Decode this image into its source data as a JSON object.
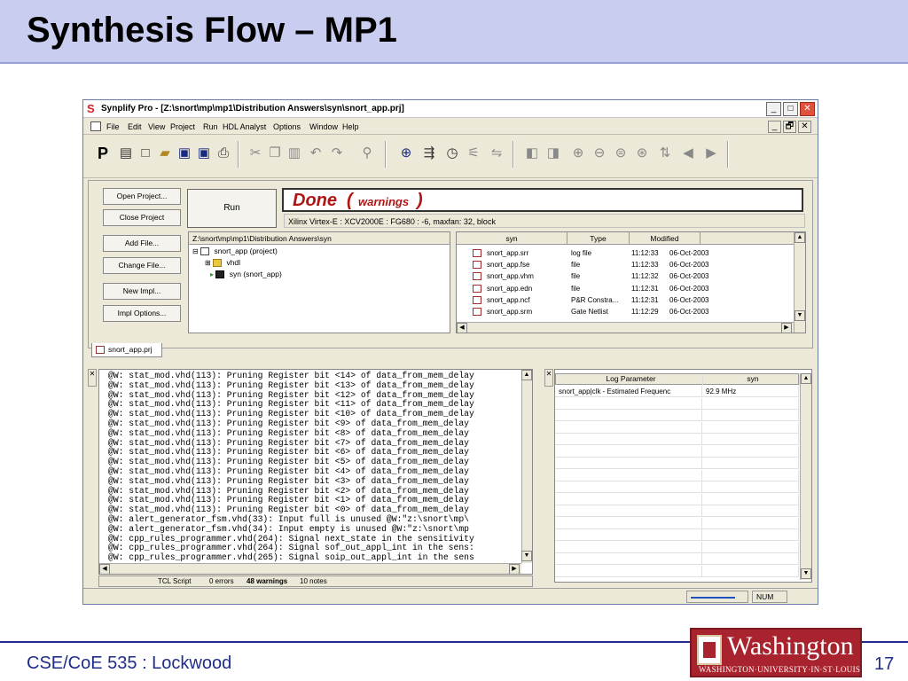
{
  "slide": {
    "title": "Synthesis Flow – MP1",
    "footer": "CSE/CoE 535 : Lockwood",
    "page_number": "17",
    "logo_main": "Washington",
    "logo_sub": "WASHINGTON·UNIVERSITY·IN·ST·LOUIS",
    "colors": {
      "header_bg": "#c9cdf0",
      "footer_text": "#1f2d8a",
      "logo_bg": "#a8232d"
    }
  },
  "window": {
    "title": "Synplify Pro - [Z:\\snort\\mp\\mp1\\Distribution Answers\\syn\\snort_app.prj]",
    "controls": {
      "minimize": "_",
      "maximize": "□",
      "close": "✕"
    },
    "mdi_controls": {
      "minimize": "_",
      "restore": "🗗",
      "close": "✕"
    }
  },
  "menu": [
    "File",
    "Edit",
    "View",
    "Project",
    "Run",
    "HDL Analyst",
    "Options",
    "Window",
    "Help"
  ],
  "toolbar": {
    "icons": [
      "p-logo-icon",
      "hdl-icon",
      "new-file-icon",
      "open-folder-icon",
      "save-icon",
      "save-all-icon",
      "print-icon",
      "cut-icon",
      "copy-icon",
      "paste-icon",
      "undo-icon",
      "redo-icon",
      "find-icon",
      "zoom-icon",
      "push-icon",
      "timer-icon",
      "filter-icon",
      "flatten-icon",
      "back-icon",
      "forward-icon",
      "zoom-in-icon",
      "zoom-out-icon",
      "zoom-fit-icon",
      "zoom-full-icon",
      "sort-icon",
      "prev-icon",
      "next-icon"
    ]
  },
  "project": {
    "buttons": [
      "Open Project...",
      "Close Project",
      "Add File...",
      "Change File...",
      "New Impl...",
      "Impl Options..."
    ],
    "run_label": "Run",
    "status_done": "Done",
    "status_open": "(",
    "status_warnings": "warnings",
    "status_close": ")",
    "device": "Xilinx Virtex-E : XCV2000E : FG680 : -6,  maxfan: 32,  block",
    "tree_path": "Z:\\snort\\mp\\mp1\\Distribution Answers\\syn",
    "tree": [
      {
        "label": "snort_app (project)"
      },
      {
        "label": "vhdl"
      },
      {
        "label": "syn   (snort_app)"
      }
    ],
    "file_columns": [
      "syn",
      "Type",
      "Modified"
    ],
    "files": [
      {
        "name": "snort_app.srr",
        "type": "log file",
        "time": "11:12:33",
        "date": "06-Oct-2003"
      },
      {
        "name": "snort_app.fse",
        "type": "file",
        "time": "11:12:33",
        "date": "06-Oct-2003"
      },
      {
        "name": "snort_app.vhm",
        "type": "file",
        "time": "11:12:32",
        "date": "06-Oct-2003"
      },
      {
        "name": "snort_app.edn",
        "type": "file",
        "time": "11:12:31",
        "date": "06-Oct-2003"
      },
      {
        "name": "snort_app.ncf",
        "type": "P&R Constra...",
        "time": "11:12:31",
        "date": "06-Oct-2003"
      },
      {
        "name": "snort_app.srm",
        "type": "Gate Netlist",
        "time": "11:12:29",
        "date": "06-Oct-2003"
      }
    ],
    "project_tab": "snort_app.prj"
  },
  "log": {
    "lines": [
      "@W: stat_mod.vhd(113): Pruning Register bit <14> of data_from_mem_delay",
      "@W: stat_mod.vhd(113): Pruning Register bit <13> of data_from_mem_delay",
      "@W: stat_mod.vhd(113): Pruning Register bit <12> of data_from_mem_delay",
      "@W: stat_mod.vhd(113): Pruning Register bit <11> of data_from_mem_delay",
      "@W: stat_mod.vhd(113): Pruning Register bit <10> of data_from_mem_delay",
      "@W: stat_mod.vhd(113): Pruning Register bit <9> of data_from_mem_delay",
      "@W: stat_mod.vhd(113): Pruning Register bit <8> of data_from_mem_delay",
      "@W: stat_mod.vhd(113): Pruning Register bit <7> of data_from_mem_delay",
      "@W: stat_mod.vhd(113): Pruning Register bit <6> of data_from_mem_delay",
      "@W: stat_mod.vhd(113): Pruning Register bit <5> of data_from_mem_delay",
      "@W: stat_mod.vhd(113): Pruning Register bit <4> of data_from_mem_delay",
      "@W: stat_mod.vhd(113): Pruning Register bit <3> of data_from_mem_delay",
      "@W: stat_mod.vhd(113): Pruning Register bit <2> of data_from_mem_delay",
      "@W: stat_mod.vhd(113): Pruning Register bit <1> of data_from_mem_delay",
      "@W: stat_mod.vhd(113): Pruning Register bit <0> of data_from_mem_delay",
      "@W: alert_generator_fsm.vhd(33): Input full is unused @W:\"z:\\snort\\mp\\",
      "@W: alert_generator_fsm.vhd(34): Input empty is unused @W:\"z:\\snort\\mp",
      "@W: cpp_rules_programmer.vhd(264): Signal next_state in the sensitivity",
      "@W: cpp_rules_programmer.vhd(264): Signal sof_out_appl_int in the sens:",
      "@W: cpp_rules_programmer.vhd(265): Signal soip_out_appl_int in the sens"
    ],
    "tabs": [
      "TCL Script",
      "0 errors",
      "48 warnings",
      "10 notes"
    ]
  },
  "params": {
    "columns": [
      "Log Parameter",
      "syn"
    ],
    "rows": [
      {
        "param": "snort_app|clk - Estimated Frequenc",
        "value": "92.9 MHz"
      }
    ]
  },
  "statusbar": {
    "num": "NUM"
  }
}
